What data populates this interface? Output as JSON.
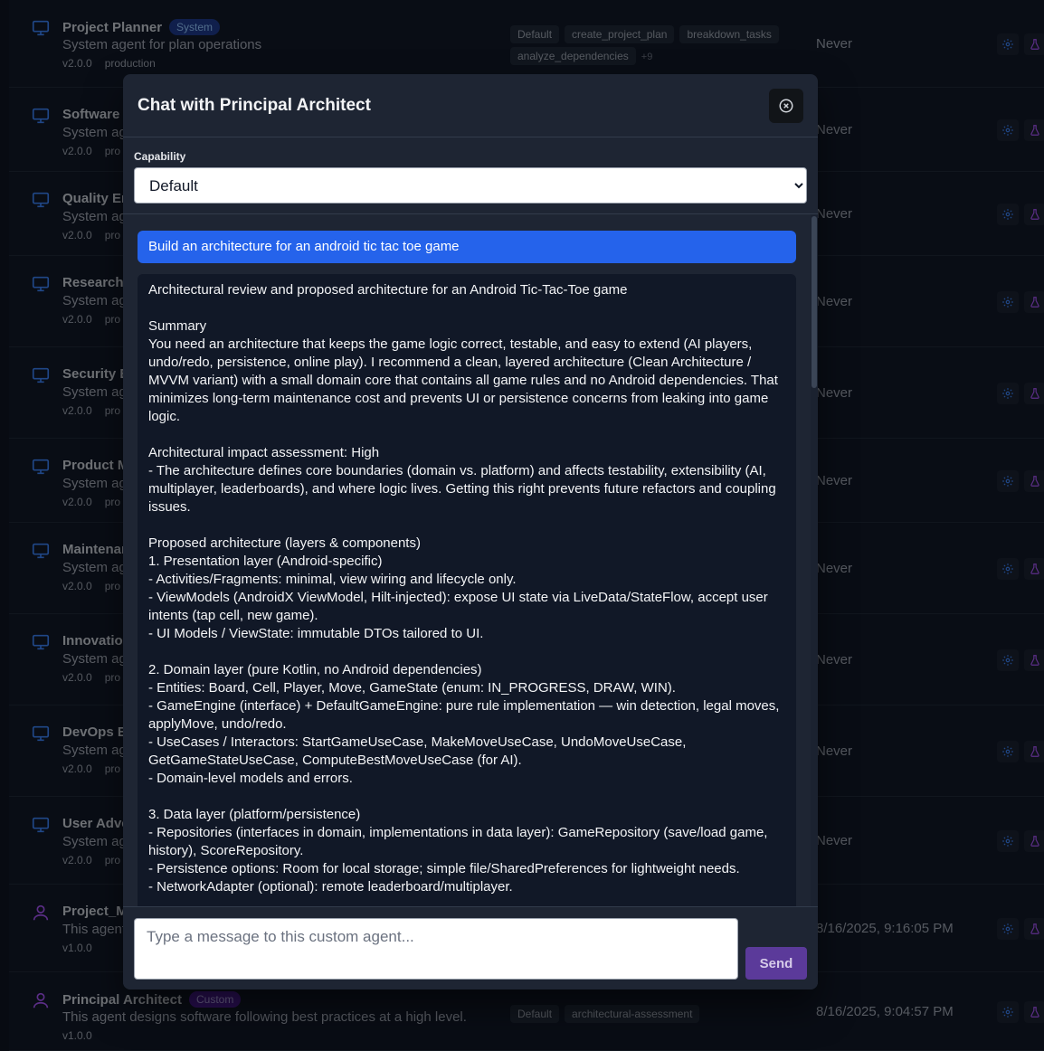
{
  "agents": [
    {
      "name": "Project Planner",
      "badge": "System",
      "badge_kind": "system",
      "icon": "monitor-icon",
      "desc": "System agent for plan operations",
      "version": "v2.0.0",
      "env": "production",
      "caps": [
        "Default",
        "create_project_plan",
        "breakdown_tasks",
        "analyze_dependencies"
      ],
      "more": "+9",
      "last": "Never"
    },
    {
      "name": "Software E",
      "badge": "",
      "badge_kind": "system",
      "icon": "monitor-icon",
      "desc": "System ag",
      "version": "v2.0.0",
      "env": "pro",
      "caps": [],
      "more": "",
      "last": "Never"
    },
    {
      "name": "Quality En",
      "badge": "",
      "badge_kind": "system",
      "icon": "monitor-icon",
      "desc": "System ag",
      "version": "v2.0.0",
      "env": "pro",
      "caps": [],
      "more": "",
      "last": "Never"
    },
    {
      "name": "Research",
      "badge": "",
      "badge_kind": "system",
      "icon": "monitor-icon",
      "desc": "System ag",
      "version": "v2.0.0",
      "env": "pro",
      "caps": [],
      "more": "",
      "last": "Never"
    },
    {
      "name": "Security E",
      "badge": "",
      "badge_kind": "system",
      "icon": "monitor-icon",
      "desc": "System ag",
      "version": "v2.0.0",
      "env": "pro",
      "caps": [],
      "more": "",
      "last": "Never"
    },
    {
      "name": "Product M",
      "badge": "",
      "badge_kind": "system",
      "icon": "monitor-icon",
      "desc": "System ag",
      "version": "v2.0.0",
      "env": "pro",
      "caps": [],
      "more": "",
      "last": "Never"
    },
    {
      "name": "Maintenar",
      "badge": "",
      "badge_kind": "system",
      "icon": "monitor-icon",
      "desc": "System ag",
      "version": "v2.0.0",
      "env": "pro",
      "caps": [],
      "more": "",
      "last": "Never"
    },
    {
      "name": "Innovatior",
      "badge": "",
      "badge_kind": "system",
      "icon": "monitor-icon",
      "desc": "System ag",
      "version": "v2.0.0",
      "env": "pro",
      "caps": [],
      "more": "",
      "last": "Never"
    },
    {
      "name": "DevOps Er",
      "badge": "",
      "badge_kind": "system",
      "icon": "monitor-icon",
      "desc": "System ag",
      "version": "v2.0.0",
      "env": "pro",
      "caps": [],
      "more": "",
      "last": "Never"
    },
    {
      "name": "User Advc",
      "badge": "",
      "badge_kind": "system",
      "icon": "monitor-icon",
      "desc": "System ag",
      "version": "v2.0.0",
      "env": "pro",
      "caps": [],
      "more": "",
      "last": "Never"
    },
    {
      "name": "Project_M",
      "badge": "",
      "badge_kind": "custom",
      "icon": "user-icon",
      "desc": "This agent",
      "version": "v1.0.0",
      "env": "",
      "caps": [],
      "more": "",
      "last": "8/16/2025, 9:16:05 PM"
    },
    {
      "name": "Principal Architect",
      "badge": "Custom",
      "badge_kind": "custom",
      "icon": "user-icon",
      "desc": "This agent designs software following best practices at a high level.",
      "version": "v1.0.0",
      "env": "",
      "caps": [
        "Default",
        "architectural-assessment"
      ],
      "more": "",
      "last": "8/16/2025, 9:04:57 PM"
    }
  ],
  "modal": {
    "title": "Chat with Principal Architect",
    "capability_label": "Capability",
    "capability_selected": "Default",
    "user_message": "Build an architecture for an android tic tac toe game",
    "agent_message": "Architectural review and proposed architecture for an Android Tic-Tac-Toe game\n\nSummary\nYou need an architecture that keeps the game logic correct, testable, and easy to extend (AI players, undo/redo, persistence, online play). I recommend a clean, layered architecture (Clean Architecture / MVVM variant) with a small domain core that contains all game rules and no Android dependencies. That minimizes long-term maintenance cost and prevents UI or persistence concerns from leaking into game logic.\n\nArchitectural impact assessment: High\n- The architecture defines core boundaries (domain vs. platform) and affects testability, extensibility (AI, multiplayer, leaderboards), and where logic lives. Getting this right prevents future refactors and coupling issues.\n\nProposed architecture (layers & components)\n1. Presentation layer (Android-specific)\n- Activities/Fragments: minimal, view wiring and lifecycle only.\n- ViewModels (AndroidX ViewModel, Hilt-injected): expose UI state via LiveData/StateFlow, accept user intents (tap cell, new game).\n- UI Models / ViewState: immutable DTOs tailored to UI.\n\n2. Domain layer (pure Kotlin, no Android dependencies)\n- Entities: Board, Cell, Player, Move, GameState (enum: IN_PROGRESS, DRAW, WIN).\n- GameEngine (interface) + DefaultGameEngine: pure rule implementation — win detection, legal moves, applyMove, undo/redo.\n- UseCases / Interactors: StartGameUseCase, MakeMoveUseCase, UndoMoveUseCase, GetGameStateUseCase, ComputeBestMoveUseCase (for AI).\n- Domain-level models and errors.\n\n3. Data layer (platform/persistence)\n- Repositories (interfaces in domain, implementations in data layer): GameRepository (save/load game, history), ScoreRepository.\n- Persistence options: Room for local storage; simple file/SharedPreferences for lightweight needs.\n- NetworkAdapter (optional): remote leaderboard/multiplayer.",
    "input_placeholder": "Type a message to this custom agent...",
    "send_label": "Send"
  }
}
